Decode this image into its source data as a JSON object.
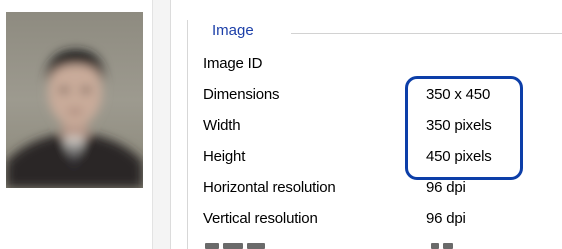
{
  "thumbnail": {
    "icon": "person-photo"
  },
  "properties": {
    "group_title": "Image",
    "rows": [
      {
        "label": "Image ID",
        "value": ""
      },
      {
        "label": "Dimensions",
        "value": "350 x 450"
      },
      {
        "label": "Width",
        "value": "350 pixels"
      },
      {
        "label": "Height",
        "value": "450 pixels"
      },
      {
        "label": "Horizontal resolution",
        "value": "96 dpi"
      },
      {
        "label": "Vertical resolution",
        "value": "96 dpi"
      }
    ]
  },
  "colors": {
    "group_title": "#1c3fa8",
    "highlight": "#0c3ea8"
  }
}
